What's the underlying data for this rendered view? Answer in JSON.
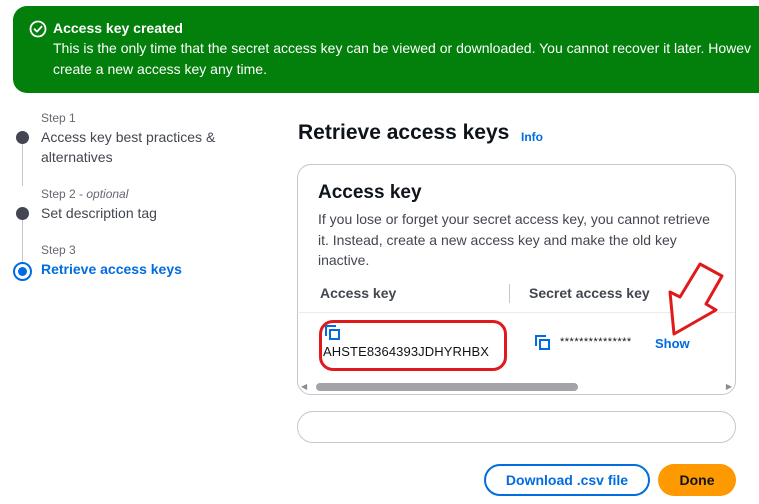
{
  "banner": {
    "title": "Access key created",
    "line1": "This is the only time that the secret access key can be viewed or downloaded. You cannot recover it later. Howev",
    "line2": "create a new access key any time.",
    "color": "#037f0c",
    "icon": "check-circle-icon"
  },
  "steps": [
    {
      "number": "Step 1",
      "optional": "",
      "label": "Access key best practices &",
      "label2": "alternatives"
    },
    {
      "number": "Step 2 - ",
      "optional": "optional",
      "label": "Set description tag"
    },
    {
      "number": "Step 3",
      "optional": "",
      "label": "Retrieve access keys"
    }
  ],
  "main": {
    "title": "Retrieve access keys",
    "info_link": "Info"
  },
  "card": {
    "title": "Access key",
    "description": "If you lose or forget your secret access key, you cannot retrieve it. Instead, create a new access key and make the old key inactive.",
    "columns": [
      "Access key",
      "Secret access key"
    ],
    "access_key_value": "AHSTE8364393JDHYRHBX",
    "secret_mask": "***************",
    "show_label": "Show"
  },
  "buttons": {
    "download_csv": "Download .csv file",
    "done": "Done"
  },
  "colors": {
    "accent": "#006ce0",
    "primary_button": "#ff9900",
    "annotation": "#e01a1a"
  }
}
